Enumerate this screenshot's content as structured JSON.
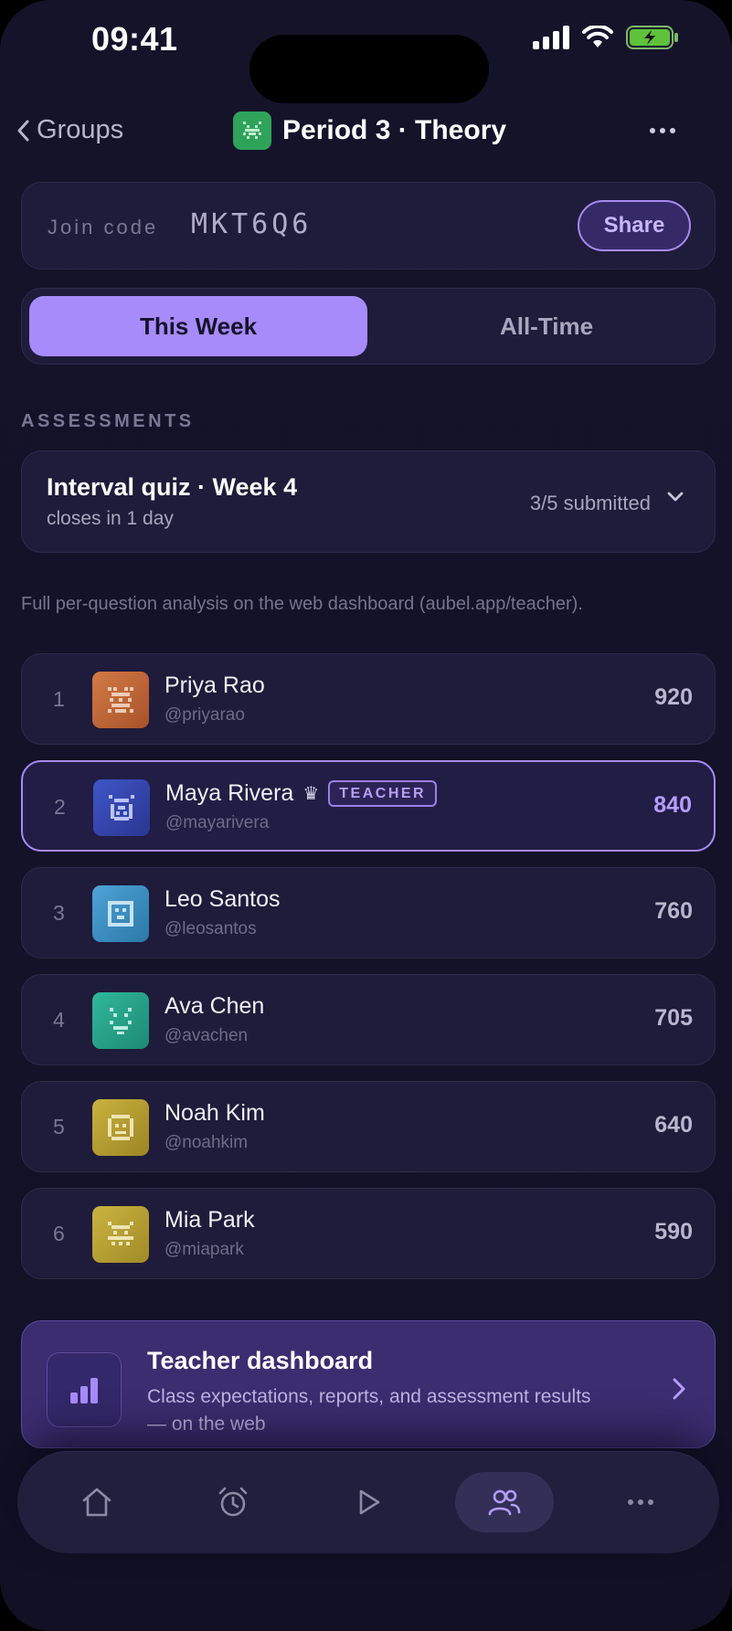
{
  "status_bar": {
    "time": "09:41"
  },
  "nav": {
    "back_label": "Groups",
    "title": "Period 3 · Theory"
  },
  "join": {
    "label": "Join code",
    "code": "MKT6Q6",
    "share_label": "Share"
  },
  "segment": {
    "options": [
      "This Week",
      "All-Time"
    ],
    "selected": "This Week"
  },
  "assessments": {
    "section_label": "ASSESSMENTS",
    "current": {
      "title": "Interval quiz · Week 4",
      "subtitle": "closes in 1 day",
      "submitted": "3/5 submitted"
    },
    "note": "Full per-question analysis on the web dashboard (aubel.app/teacher)."
  },
  "leaderboard": [
    {
      "rank": "1",
      "name": "Priya Rao",
      "handle": "@priyarao",
      "score": "920",
      "avatar_color": "#c2683a"
    },
    {
      "rank": "2",
      "name": "Maya Rivera",
      "crown": "♛",
      "badge": "TEACHER",
      "handle": "@mayarivera",
      "score": "840",
      "avatar_color": "#3446b0",
      "highlighted": true
    },
    {
      "rank": "3",
      "name": "Leo Santos",
      "handle": "@leosantos",
      "score": "760",
      "avatar_color": "#3d8fc4"
    },
    {
      "rank": "4",
      "name": "Ava Chen",
      "handle": "@avachen",
      "score": "705",
      "avatar_color": "#27a58c"
    },
    {
      "rank": "5",
      "name": "Noah Kim",
      "handle": "@noahkim",
      "score": "640",
      "avatar_color": "#b7a032"
    },
    {
      "rank": "6",
      "name": "Mia Park",
      "handle": "@miapark",
      "score": "590",
      "avatar_color": "#b8a434"
    }
  ],
  "dashboard_card": {
    "title": "Teacher dashboard",
    "description": "Class expectations, reports, and assessment results — on the web"
  },
  "tab_bar": {
    "tabs": [
      "home-icon",
      "alarm-icon",
      "play-icon",
      "groups-icon",
      "more-icon"
    ],
    "active": "groups-icon"
  },
  "colors": {
    "accent": "#a78bfa",
    "background": "#15132a",
    "card": "#1f1b3a"
  }
}
